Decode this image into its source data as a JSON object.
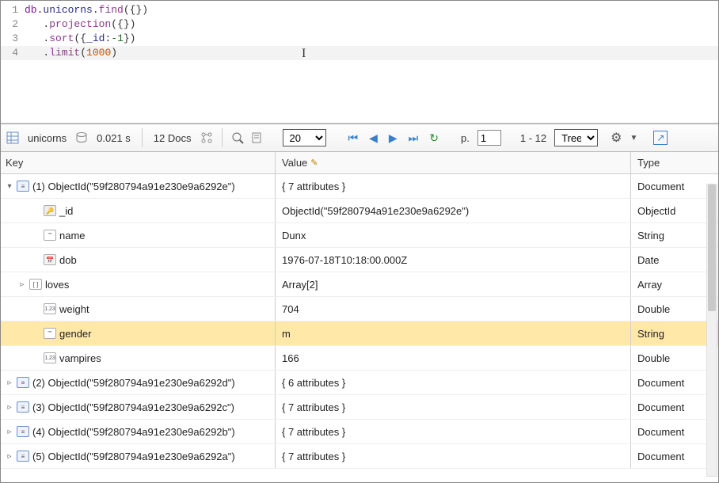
{
  "code": {
    "lines": [
      {
        "n": "1",
        "html": "<span class='tk-db'>db</span><span class='tk-brace'>.</span><span class='tk-prop'>unicorns</span><span class='tk-brace'>.</span><span class='tk-fn'>find</span><span class='tk-brace'>({})</span>"
      },
      {
        "n": "2",
        "html": "   <span class='tk-brace'>.</span><span class='tk-fn'>projection</span><span class='tk-brace'>({})</span>"
      },
      {
        "n": "3",
        "html": "   <span class='tk-brace'>.</span><span class='tk-fn'>sort</span><span class='tk-brace'>({</span><span class='tk-prop'>_id</span><span class='tk-brace'>:</span><span class='tk-num'>-1</span><span class='tk-brace'>})</span>"
      },
      {
        "n": "4",
        "html": "   <span class='tk-brace'>.</span><span class='tk-fn'>limit</span><span class='tk-brace'>(</span><span class='tk-num2'>1000</span><span class='tk-brace'>)</span>",
        "hl": true
      }
    ]
  },
  "toolbar": {
    "collection": "unicorns",
    "time": "0.021 s",
    "docs": "12 Docs",
    "page_size": "20",
    "page_label": "p.",
    "page_value": "1",
    "range": "1 - 12",
    "view": "Tree"
  },
  "headers": {
    "key": "Key",
    "value": "Value",
    "type": "Type"
  },
  "rows": [
    {
      "indent": 0,
      "toggle": "▾",
      "icon": "doc",
      "key": "(1) ObjectId(\"59f280794a91e230e9a6292e\")",
      "value": "{ 7 attributes }",
      "type": "Document"
    },
    {
      "indent": 2,
      "toggle": "",
      "icon": "key",
      "key": "_id",
      "value": "ObjectId(\"59f280794a91e230e9a6292e\")",
      "type": "ObjectId"
    },
    {
      "indent": 2,
      "toggle": "",
      "icon": "str",
      "key": "name",
      "value": "Dunx",
      "type": "String"
    },
    {
      "indent": 2,
      "toggle": "",
      "icon": "date",
      "key": "dob",
      "value": "1976-07-18T10:18:00.000Z",
      "type": "Date"
    },
    {
      "indent": 1,
      "toggle": "▹",
      "icon": "arr",
      "key": "loves",
      "value": "Array[2]",
      "type": "Array"
    },
    {
      "indent": 2,
      "toggle": "",
      "icon": "num",
      "key": "weight",
      "value": "704",
      "type": "Double"
    },
    {
      "indent": 2,
      "toggle": "",
      "icon": "str",
      "key": "gender",
      "value": "m",
      "type": "String",
      "selected": true
    },
    {
      "indent": 2,
      "toggle": "",
      "icon": "num",
      "key": "vampires",
      "value": "166",
      "type": "Double"
    },
    {
      "indent": 0,
      "toggle": "▹",
      "icon": "doc",
      "key": "(2) ObjectId(\"59f280794a91e230e9a6292d\")",
      "value": "{ 6 attributes }",
      "type": "Document"
    },
    {
      "indent": 0,
      "toggle": "▹",
      "icon": "doc",
      "key": "(3) ObjectId(\"59f280794a91e230e9a6292c\")",
      "value": "{ 7 attributes }",
      "type": "Document"
    },
    {
      "indent": 0,
      "toggle": "▹",
      "icon": "doc",
      "key": "(4) ObjectId(\"59f280794a91e230e9a6292b\")",
      "value": "{ 7 attributes }",
      "type": "Document"
    },
    {
      "indent": 0,
      "toggle": "▹",
      "icon": "doc",
      "key": "(5) ObjectId(\"59f280794a91e230e9a6292a\")",
      "value": "{ 7 attributes }",
      "type": "Document"
    }
  ]
}
